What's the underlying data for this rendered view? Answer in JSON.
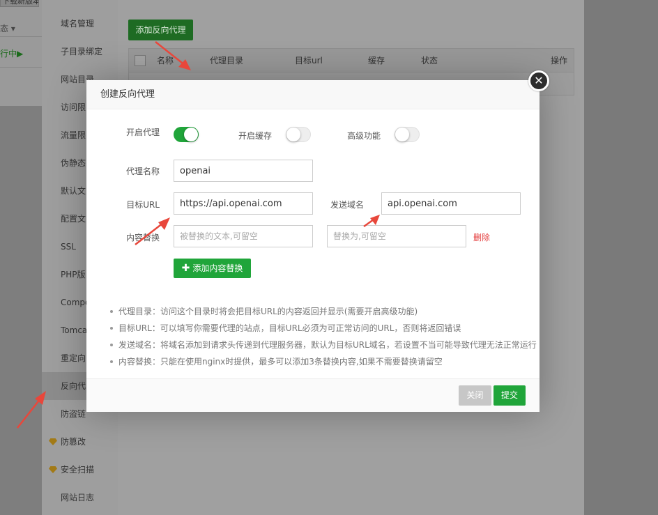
{
  "background": {
    "partial_button": "下载新版本",
    "partial_status": "态",
    "partial_running": "行中",
    "sidebar_items": [
      {
        "label": "域名管理"
      },
      {
        "label": "子目录绑定"
      },
      {
        "label": "网站目录"
      },
      {
        "label": "访问限"
      },
      {
        "label": "流量限"
      },
      {
        "label": "伪静态"
      },
      {
        "label": "默认文"
      },
      {
        "label": "配置文"
      },
      {
        "label": "SSL"
      },
      {
        "label": "PHP版"
      },
      {
        "label": "Compo"
      },
      {
        "label": "Tomca"
      },
      {
        "label": "重定向"
      },
      {
        "label": "反向代"
      },
      {
        "label": "防盗链"
      },
      {
        "label": "防篡改",
        "icon": "gem-icon"
      },
      {
        "label": "安全扫描",
        "icon": "gem-icon"
      },
      {
        "label": "网站日志"
      }
    ],
    "add_proxy_button": "添加反向代理",
    "table_headers": [
      "名称",
      "代理目录",
      "目标url",
      "缓存",
      "状态",
      "操作"
    ]
  },
  "modal": {
    "title": "创建反向代理",
    "close_icon": "close-icon",
    "enable_proxy": {
      "label": "开启代理",
      "on": true
    },
    "enable_cache": {
      "label": "开启缓存",
      "on": false
    },
    "advanced": {
      "label": "高级功能",
      "on": false
    },
    "proxy_name": {
      "label": "代理名称",
      "value": "openai"
    },
    "target_url": {
      "label": "目标URL",
      "value": "https://api.openai.com"
    },
    "send_domain": {
      "label": "发送域名",
      "value": "api.openai.com"
    },
    "content_replace": {
      "label": "内容替换",
      "source_placeholder": "被替换的文本,可留空",
      "target_placeholder": "替换为,可留空",
      "delete_label": "删除"
    },
    "add_replace_button": "添加内容替换",
    "tips": [
      "代理目录：访问这个目录时将会把目标URL的内容返回并显示(需要开启高级功能)",
      "目标URL：可以填写你需要代理的站点，目标URL必须为可正常访问的URL，否则将返回错误",
      "发送域名：将域名添加到请求头传递到代理服务器，默认为目标URL域名，若设置不当可能导致代理无法正常运行",
      "内容替换：只能在使用nginx时提供，最多可以添加3条替换内容,如果不需要替换请留空"
    ],
    "footer": {
      "close_label": "关闭",
      "submit_label": "提交"
    }
  },
  "colors": {
    "accent": "#20a53a",
    "danger": "#e43d3d",
    "arrow": "#e8473b"
  }
}
